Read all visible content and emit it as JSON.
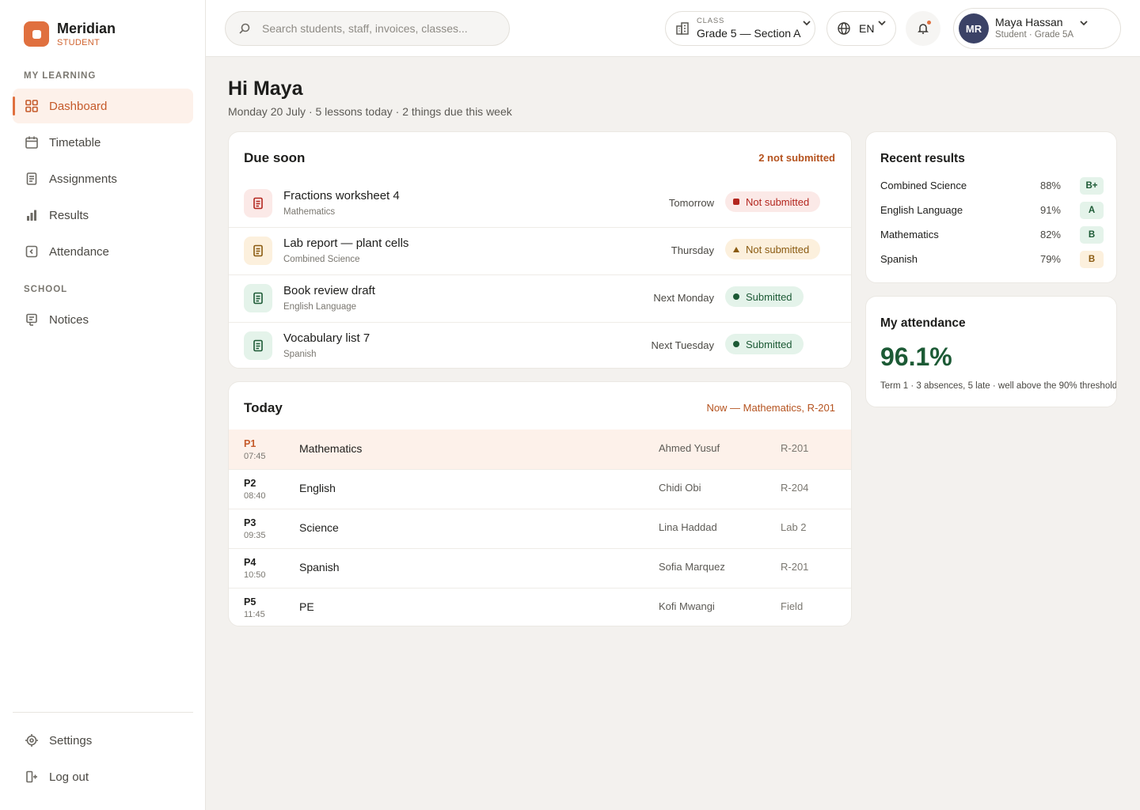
{
  "brand": {
    "name": "Meridian",
    "role": "STUDENT"
  },
  "sidebar": {
    "section_learning": "MY LEARNING",
    "section_school": "SCHOOL",
    "items": [
      {
        "label": "Dashboard",
        "icon": "grid-icon",
        "active": true
      },
      {
        "label": "Timetable",
        "icon": "calendar-icon"
      },
      {
        "label": "Assignments",
        "icon": "document-icon"
      },
      {
        "label": "Results",
        "icon": "bar-chart-icon"
      },
      {
        "label": "Attendance",
        "icon": "attendance-icon"
      },
      {
        "label": "Notices",
        "icon": "notice-icon"
      }
    ],
    "footer": [
      {
        "label": "Settings",
        "icon": "settings-icon"
      },
      {
        "label": "Log out",
        "icon": "logout-icon"
      }
    ]
  },
  "topbar": {
    "search_placeholder": "Search students, staff, invoices, classes...",
    "class_caption": "CLASS",
    "class_value": "Grade 5 — Section A",
    "language": "EN",
    "user": {
      "initials": "MR",
      "name": "Maya Hassan",
      "subtitle": "Student · Grade 5A"
    }
  },
  "greeting": {
    "title": "Hi Maya",
    "subtitle": "Monday 20 July · 5 lessons today · 2 things due this week"
  },
  "due_soon": {
    "title": "Due soon",
    "meta": "2 not submitted",
    "items": [
      {
        "title": "Fractions worksheet 4",
        "subject": "Mathematics",
        "when": "Tomorrow",
        "status": "Not submitted",
        "tone": "red"
      },
      {
        "title": "Lab report — plant cells",
        "subject": "Combined Science",
        "when": "Thursday",
        "status": "Not submitted",
        "tone": "amber"
      },
      {
        "title": "Book review draft",
        "subject": "English Language",
        "when": "Next Monday",
        "status": "Submitted",
        "tone": "green"
      },
      {
        "title": "Vocabulary list 7",
        "subject": "Spanish",
        "when": "Next Tuesday",
        "status": "Submitted",
        "tone": "green"
      }
    ]
  },
  "today": {
    "title": "Today",
    "meta": "Now — Mathematics, R-201",
    "lessons": [
      {
        "period": "P1",
        "time": "07:45",
        "subject": "Mathematics",
        "teacher": "Ahmed Yusuf",
        "room": "R-201",
        "current": true
      },
      {
        "period": "P2",
        "time": "08:40",
        "subject": "English",
        "teacher": "Chidi Obi",
        "room": "R-204"
      },
      {
        "period": "P3",
        "time": "09:35",
        "subject": "Science",
        "teacher": "Lina Haddad",
        "room": "Lab 2"
      },
      {
        "period": "P4",
        "time": "10:50",
        "subject": "Spanish",
        "teacher": "Sofia Marquez",
        "room": "R-201"
      },
      {
        "period": "P5",
        "time": "11:45",
        "subject": "PE",
        "teacher": "Kofi Mwangi",
        "room": "Field"
      }
    ]
  },
  "results": {
    "title": "Recent results",
    "rows": [
      {
        "subject": "Combined Science",
        "percent": "88%",
        "grade": "B+",
        "tone": "green"
      },
      {
        "subject": "English Language",
        "percent": "91%",
        "grade": "A",
        "tone": "green"
      },
      {
        "subject": "Mathematics",
        "percent": "82%",
        "grade": "B",
        "tone": "green"
      },
      {
        "subject": "Spanish",
        "percent": "79%",
        "grade": "B",
        "tone": "amber"
      }
    ]
  },
  "attendance": {
    "title": "My attendance",
    "value": "96.1%",
    "subtitle": "Term 1 · 3 absences, 5 late · well above the 90% threshold"
  },
  "colors": {
    "accent": "#e0703f",
    "success": "#1c5a35",
    "danger": "#b3261e",
    "warning": "#8a5a10",
    "avatar": "#3b4266"
  }
}
